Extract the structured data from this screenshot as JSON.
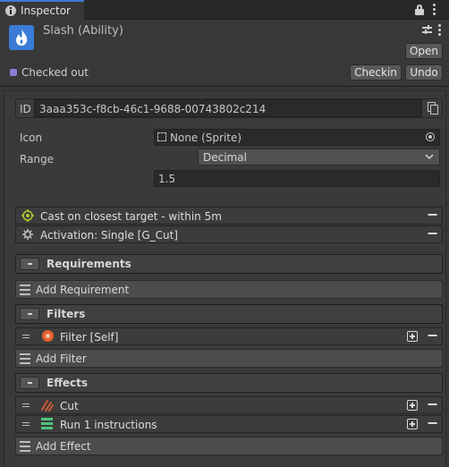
{
  "window": {
    "tab_title": "Inspector"
  },
  "header": {
    "title": "Slash (Ability)",
    "open_label": "Open"
  },
  "vcs": {
    "status": "Checked out",
    "checkin_label": "Checkin",
    "undo_label": "Undo"
  },
  "fields": {
    "id_label": "ID",
    "id_value": "3aaa353c-f8cb-46c1-9688-00743802c214",
    "icon_label": "Icon",
    "icon_value": "None (Sprite)",
    "range_label": "Range",
    "range_mode": "Decimal",
    "range_value": "1.5"
  },
  "targeting": {
    "target_label": "Cast on closest target - within 5m",
    "activation_label": "Activation: Single [G_Cut]"
  },
  "requirements": {
    "title": "Requirements",
    "add_label": "Add Requirement"
  },
  "filters": {
    "title": "Filters",
    "items": [
      {
        "label": "Filter [Self]"
      }
    ],
    "add_label": "Add Filter"
  },
  "effects": {
    "title": "Effects",
    "items": [
      {
        "label": "Cut"
      },
      {
        "label": "Run 1 instructions"
      }
    ],
    "add_label": "Add Effect"
  },
  "colors": {
    "accent_blue": "#3a7bd5",
    "panel_bg": "#383838",
    "filter_icon": "#e2622e",
    "effect_cut_icon": "#d05a3a",
    "run_icon": "#4fc47e",
    "target_icon": "#b6c832"
  }
}
